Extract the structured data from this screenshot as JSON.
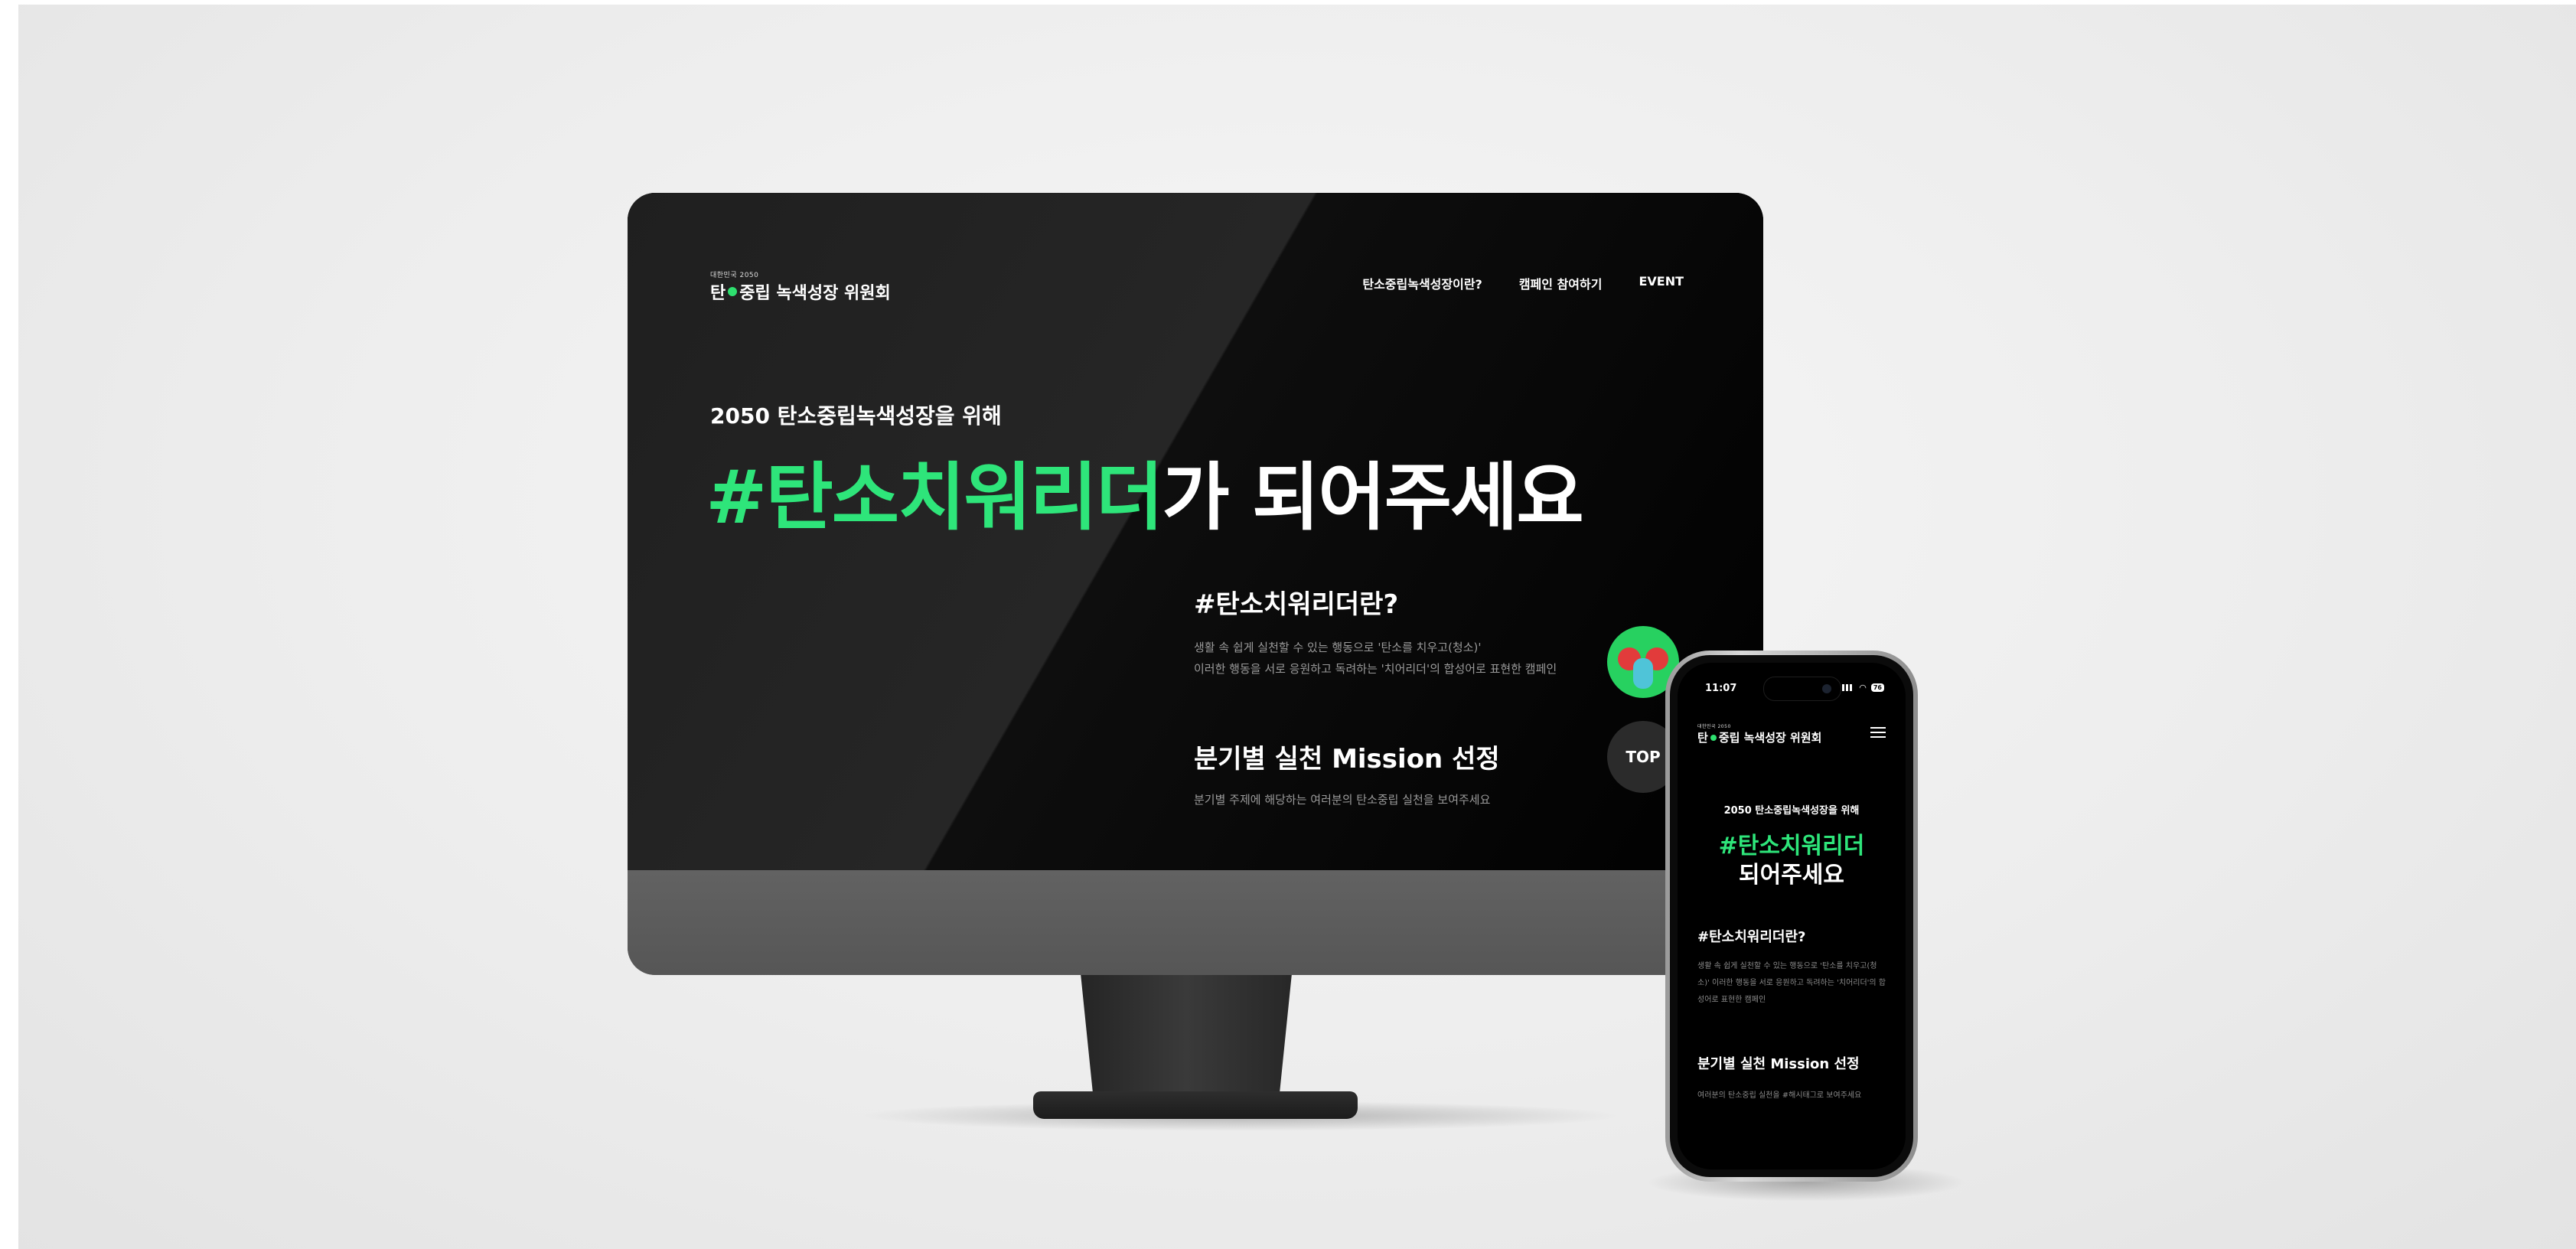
{
  "site": {
    "logo_small": "대한민국 2050",
    "logo_main_a": "탄",
    "logo_main_b": "중립 녹색성장 위원회",
    "nav": [
      {
        "label": "탄소중립녹색성장이란?"
      },
      {
        "label": "캠페인 참여하기"
      },
      {
        "label": "EVENT"
      }
    ],
    "hero": {
      "eyebrow": "2050 탄소중립녹색성장을 위해",
      "headline_accent": "#탄소치워리더",
      "headline_rest": "가 되어주세요"
    },
    "info": [
      {
        "title": "#탄소치워리더란?",
        "desc_line1": "생활 속 쉽게 실천할 수 있는 행동으로 '탄소를 치우고(청소)'",
        "desc_line2": "이러한 행동을 서로 응원하고 독려하는 '치어리더'의 합성어로 표현한 캠페인"
      },
      {
        "title": "분기별 실천 Mission 선정",
        "desc": "분기별 주제에 해당하는 여러분의 탄소중립 실천을 보여주세요"
      }
    ],
    "top_button": "TOP"
  },
  "mobile": {
    "status_time": "11:07",
    "battery": "76",
    "eyebrow": "2050 탄소중립녹색성장을 위해",
    "headline_line1": "#탄소치워리더",
    "headline_line2": "되어주세요",
    "info": [
      {
        "title": "#탄소치워리더란?",
        "desc": "생활 속 쉽게 실천할 수 있는 행동으로 '탄소를 치우고(청소)' 이러한 행동을 서로 응원하고 독려하는 '치어리더'의 합성어로 표현한 캠페인"
      },
      {
        "title": "분기별 실천 Mission 선정",
        "desc": "여러분의 탄소중립 실천을 #해시태그로 보여주세요"
      }
    ]
  },
  "colors": {
    "accent": "#2ee57a",
    "background": "#000000",
    "character_bg": "#27d160"
  }
}
